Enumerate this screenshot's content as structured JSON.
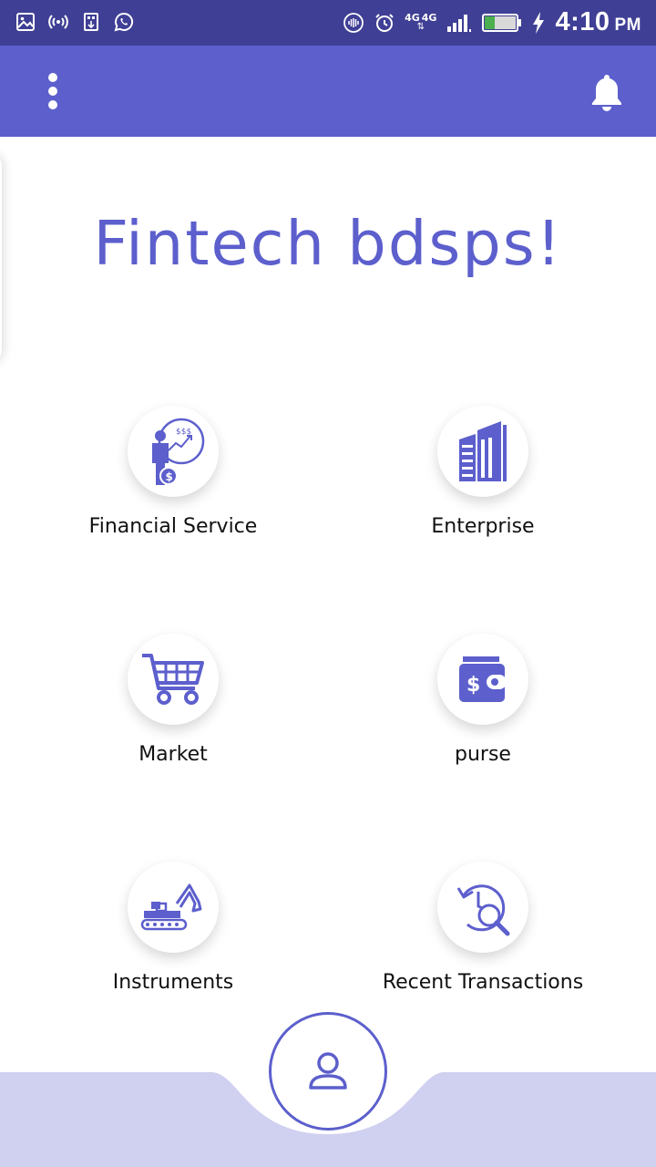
{
  "status_bar": {
    "network_label": "4G",
    "network_label_2": "4G",
    "time": "4:10",
    "ampm": "PM",
    "icons": [
      "image-icon",
      "hotspot-icon",
      "usb-icon",
      "whatsapp-icon",
      "vibrate-icon",
      "alarm-icon",
      "signal-icon",
      "battery-icon",
      "charging-icon"
    ]
  },
  "app_bar": {
    "menu_icon": "more-vert-icon",
    "notification_icon": "bell-icon",
    "accent_color": "#5c5fcc"
  },
  "header": {
    "title": "Fintech bdsps!"
  },
  "menu": {
    "items": [
      {
        "label": "Financial Service",
        "icon": "financial-service-icon"
      },
      {
        "label": "Enterprise",
        "icon": "enterprise-building-icon"
      },
      {
        "label": "Market",
        "icon": "shopping-cart-icon"
      },
      {
        "label": "purse",
        "icon": "wallet-icon"
      },
      {
        "label": "Instruments",
        "icon": "excavator-icon"
      },
      {
        "label": "Recent Transactions",
        "icon": "transaction-history-icon"
      }
    ]
  },
  "bottom_bar": {
    "profile_icon": "user-icon",
    "background_color": "#d0d0f0"
  }
}
